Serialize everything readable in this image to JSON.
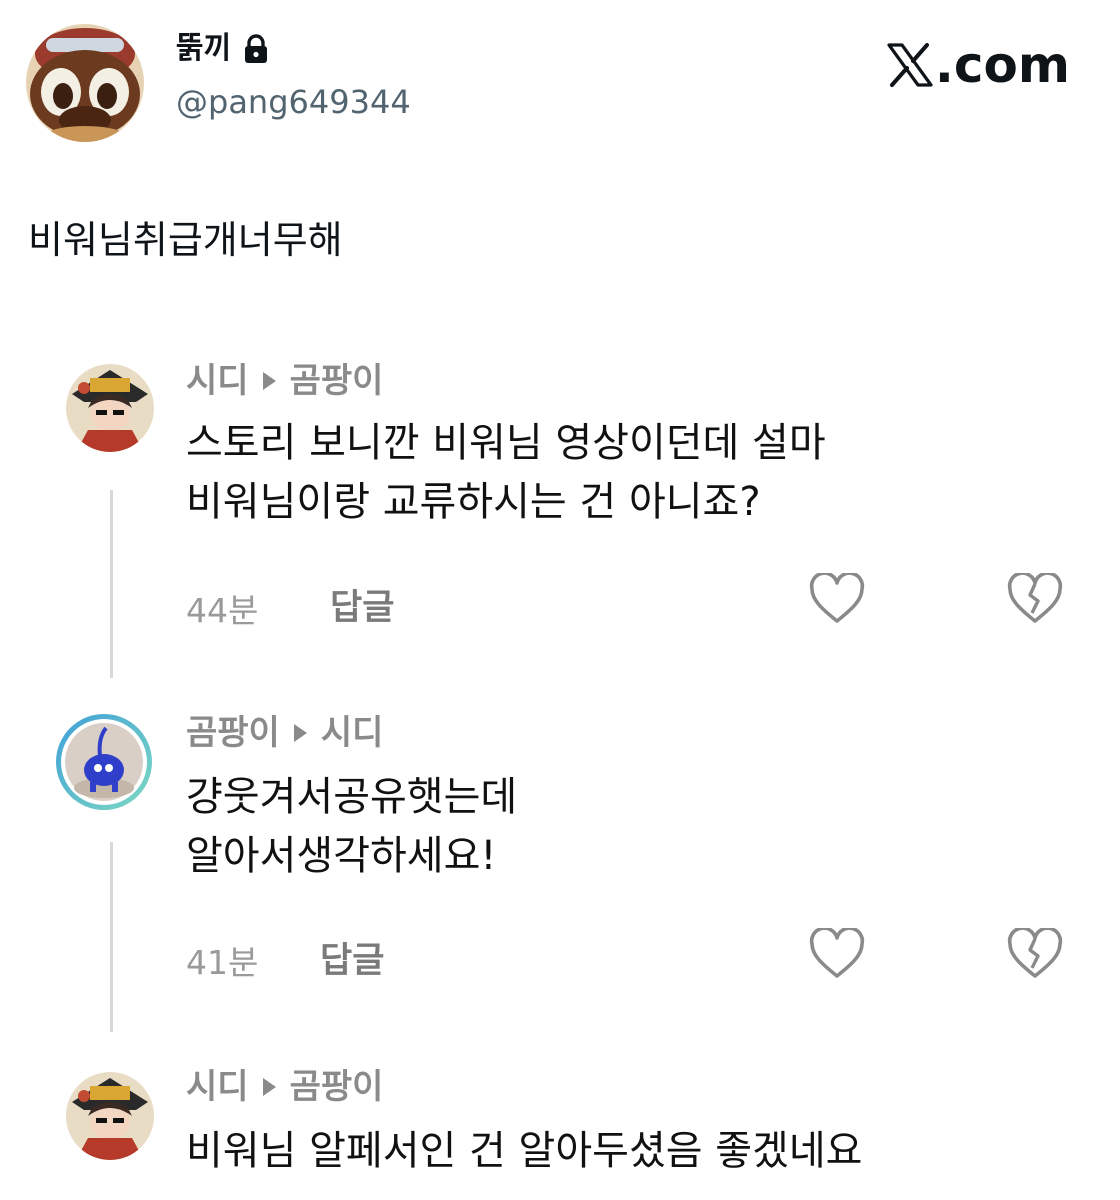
{
  "tweet": {
    "author_name": "뚥끼",
    "author_handle": "@pang649344",
    "brand": ".com",
    "text": "비워님취급개너무해"
  },
  "comments": [
    {
      "author": "시디",
      "reply_to": "곰팡이",
      "text": "스토리 보니깐 비워님 영상이던데 설마\n비워님이랑 교류하시는 건 아니죠?",
      "time": "44분",
      "reply_label": "답글"
    },
    {
      "author": "곰팡이",
      "reply_to": "시디",
      "text": "걍웃겨서공유햇는데\n알아서생각하세요!",
      "time": "41분",
      "reply_label": "답글"
    },
    {
      "author": "시디",
      "reply_to": "곰팡이",
      "text": "비워님 알페서인 건 알아두셨음 좋겠네요"
    }
  ],
  "colors": {
    "text_primary": "#0f1419",
    "text_secondary": "#536471",
    "meta_gray": "#8a8a8a",
    "ring_teal": "#5ec3e6"
  },
  "icons": [
    "lock-icon",
    "x-logo-icon",
    "heart-icon",
    "broken-heart-icon",
    "arrow-right-icon"
  ]
}
